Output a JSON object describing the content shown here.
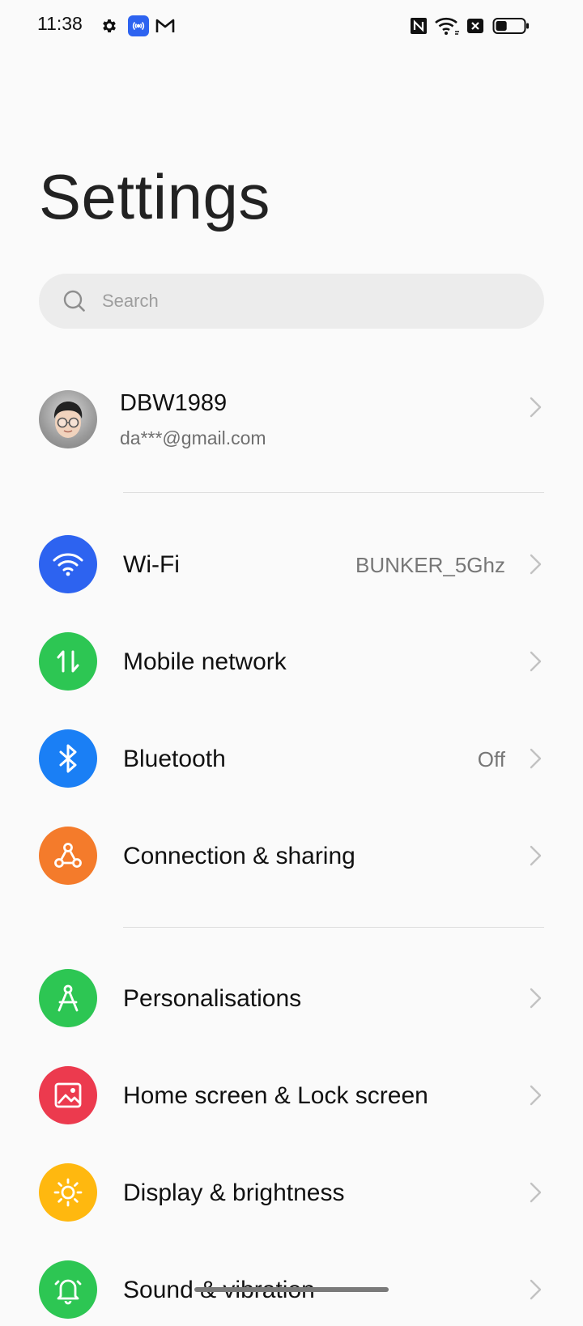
{
  "status_bar": {
    "time": "11:38",
    "left_icons": [
      "settings-gear-icon",
      "hotspot-broadcast-icon",
      "gmail-icon"
    ],
    "right_icons": [
      "nfc-icon",
      "wifi-icon",
      "no-sim-icon",
      "battery-icon"
    ],
    "battery_level": 0.4
  },
  "page": {
    "title": "Settings"
  },
  "search": {
    "placeholder": "Search"
  },
  "account": {
    "name": "DBW1989",
    "email": "da***@gmail.com"
  },
  "rows": [
    {
      "label": "Wi-Fi",
      "value": "BUNKER_5Ghz",
      "icon": "wifi-icon",
      "color": "#2d63f0"
    },
    {
      "label": "Mobile network",
      "value": "",
      "icon": "mobile-data-arrows-icon",
      "color": "#2dc653"
    },
    {
      "label": "Bluetooth",
      "value": "Off",
      "icon": "bluetooth-icon",
      "color": "#1a7ff5"
    },
    {
      "label": "Connection & sharing",
      "value": "",
      "icon": "connection-share-icon",
      "color": "#f47b2b"
    },
    {
      "label": "Personalisations",
      "value": "",
      "icon": "compass-drawing-icon",
      "color": "#2dc653"
    },
    {
      "label": "Home screen & Lock screen",
      "value": "",
      "icon": "picture-icon",
      "color": "#ec3a4e"
    },
    {
      "label": "Display & brightness",
      "value": "",
      "icon": "sun-brightness-icon",
      "color": "#ffb80f"
    },
    {
      "label": "Sound & vibration",
      "value": "",
      "icon": "bell-icon",
      "color": "#2dc653"
    }
  ]
}
